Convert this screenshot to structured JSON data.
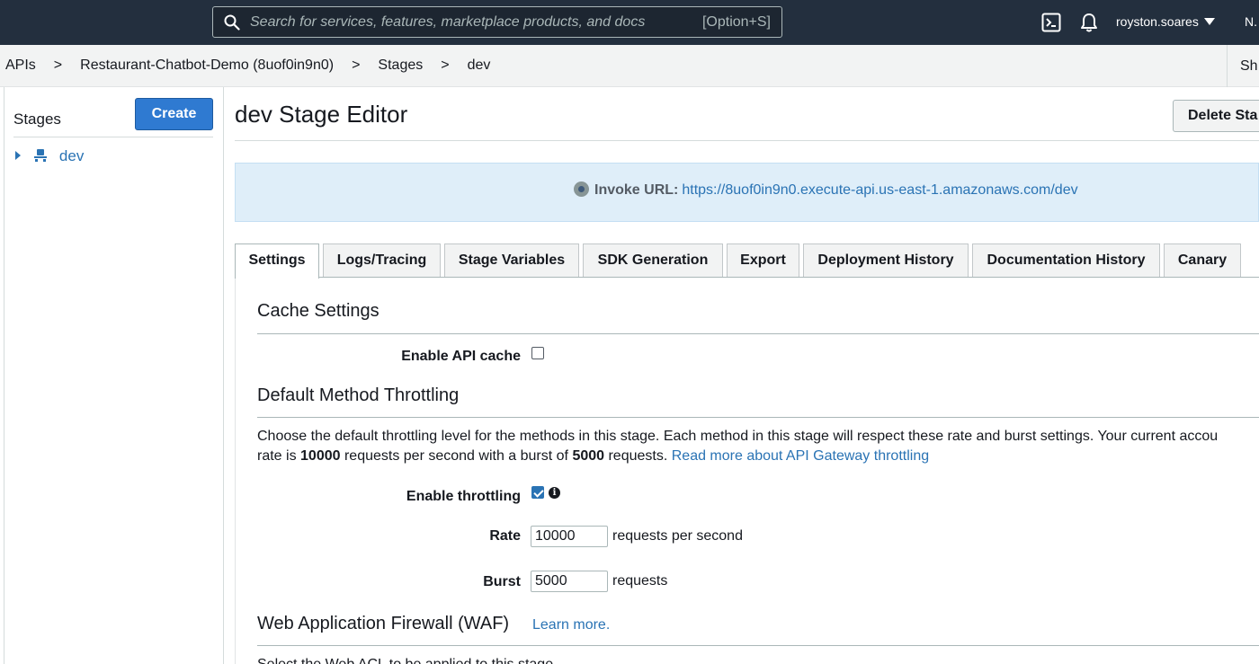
{
  "topnav": {
    "search_placeholder": "Search for services, features, marketplace products, and docs",
    "search_shortcut": "[Option+S]",
    "user": "royston.soares",
    "region": "N."
  },
  "breadcrumb": {
    "items": [
      "APIs",
      "Restaurant-Chatbot-Demo (8uof0in9n0)",
      "Stages",
      "dev"
    ],
    "separator": ">",
    "right_action": "Sh"
  },
  "sidebar": {
    "title": "Stages",
    "create_label": "Create",
    "items": [
      {
        "label": "dev"
      }
    ]
  },
  "main": {
    "title": "dev Stage Editor",
    "delete_label": "Delete Sta",
    "invoke": {
      "label": "Invoke URL:",
      "url": "https://8uof0in9n0.execute-api.us-east-1.amazonaws.com/dev"
    },
    "tabs": [
      {
        "label": "Settings",
        "active": true
      },
      {
        "label": "Logs/Tracing"
      },
      {
        "label": "Stage Variables"
      },
      {
        "label": "SDK Generation"
      },
      {
        "label": "Export"
      },
      {
        "label": "Deployment History"
      },
      {
        "label": "Documentation History"
      },
      {
        "label": "Canary"
      }
    ],
    "cache": {
      "title": "Cache Settings",
      "enable_label": "Enable API cache",
      "enabled": false
    },
    "throttling": {
      "title": "Default Method Throttling",
      "desc_line1": "Choose the default throttling level for the methods in this stage. Each method in this stage will respect these rate and burst settings. Your current accou",
      "desc_prefix": "rate is ",
      "rate_limit": "10000",
      "desc_mid": " requests per second with a burst of ",
      "burst_limit": "5000",
      "desc_suffix": " requests. ",
      "read_more": "Read more about API Gateway throttling",
      "enable_label": "Enable throttling",
      "enabled": true,
      "rate_label": "Rate",
      "rate_value": "10000",
      "rate_unit": "requests per second",
      "burst_label": "Burst",
      "burst_value": "5000",
      "burst_unit": "requests"
    },
    "waf": {
      "title": "Web Application Firewall (WAF)",
      "learn_more": "Learn more.",
      "partial_text": "Select the Web ACL to be applied to this stage"
    }
  }
}
